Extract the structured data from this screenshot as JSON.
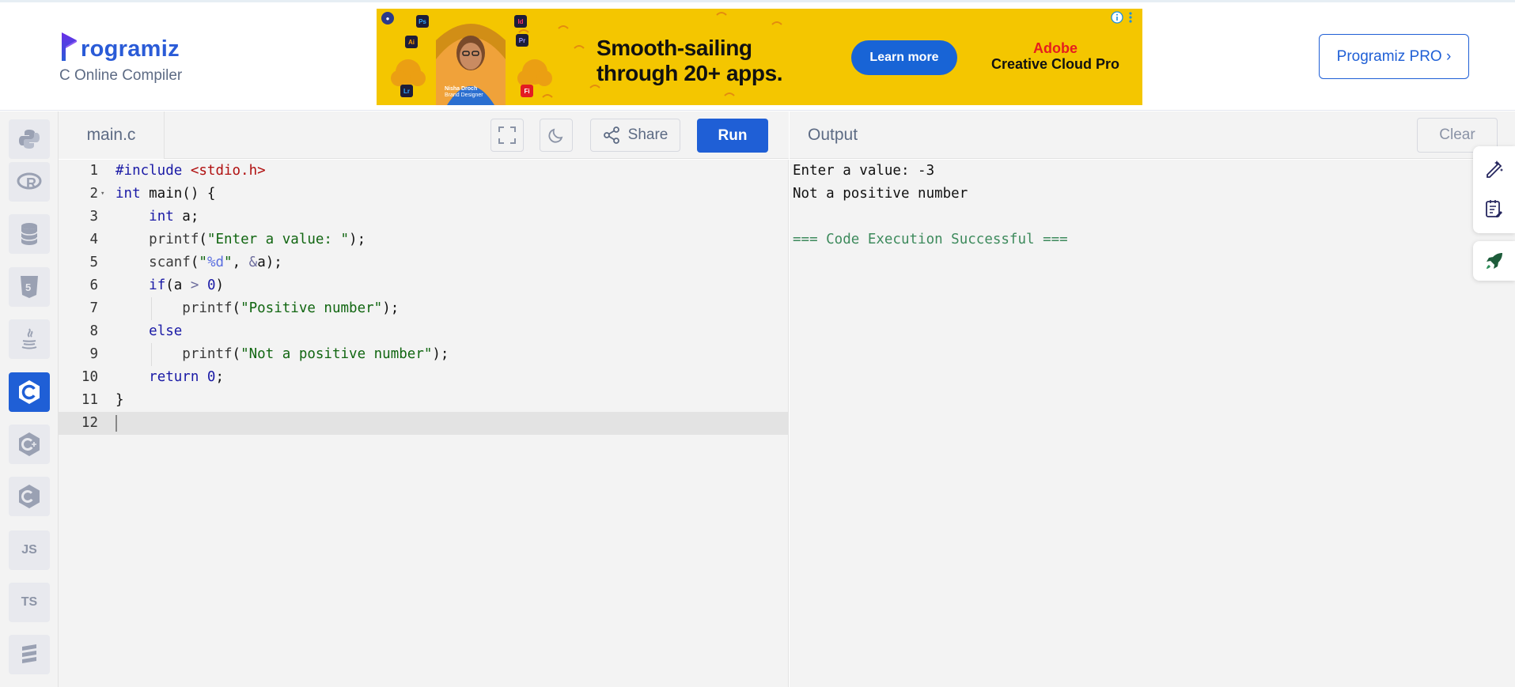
{
  "header": {
    "logo_text": "rogramiz",
    "subtitle": "C Online Compiler",
    "pro_button": "Programiz PRO ›"
  },
  "ad": {
    "headline_line1": "Smooth-sailing",
    "headline_line2": "through 20+ apps.",
    "cta": "Learn more",
    "brand_line1": "Adobe",
    "brand_line2": "Creative Cloud Pro",
    "person_name": "Nisha Droch",
    "person_role": "Brand Designer",
    "app_tiles": [
      "Ps",
      "Id",
      "Ai",
      "Pr",
      "Lr",
      "Fi"
    ]
  },
  "sidebar": {
    "languages": [
      {
        "name": "python",
        "label": "",
        "active": false
      },
      {
        "name": "r",
        "label": "R",
        "active": false
      },
      {
        "name": "sql",
        "label": "",
        "active": false
      },
      {
        "name": "html",
        "label": "5",
        "active": false
      },
      {
        "name": "java",
        "label": "",
        "active": false
      },
      {
        "name": "c",
        "label": "C",
        "active": true
      },
      {
        "name": "cpp",
        "label": "C",
        "active": false
      },
      {
        "name": "csharp",
        "label": "C",
        "active": false
      },
      {
        "name": "javascript",
        "label": "JS",
        "active": false
      },
      {
        "name": "typescript",
        "label": "TS",
        "active": false
      },
      {
        "name": "swift",
        "label": "",
        "active": false
      }
    ]
  },
  "editor": {
    "file_tab": "main.c",
    "share_label": "Share",
    "run_label": "Run",
    "line_numbers": [
      "1",
      "2",
      "3",
      "4",
      "5",
      "6",
      "7",
      "8",
      "9",
      "10",
      "11",
      "12"
    ],
    "current_line": 12
  },
  "output": {
    "title": "Output",
    "clear_label": "Clear",
    "lines": [
      "Enter a value: -3",
      "Not a positive number",
      "",
      "=== Code Execution Successful ==="
    ]
  },
  "colors": {
    "accent": "#1f5fd6",
    "ad_background": "#f4c600",
    "success_text": "#3d8a5c"
  }
}
